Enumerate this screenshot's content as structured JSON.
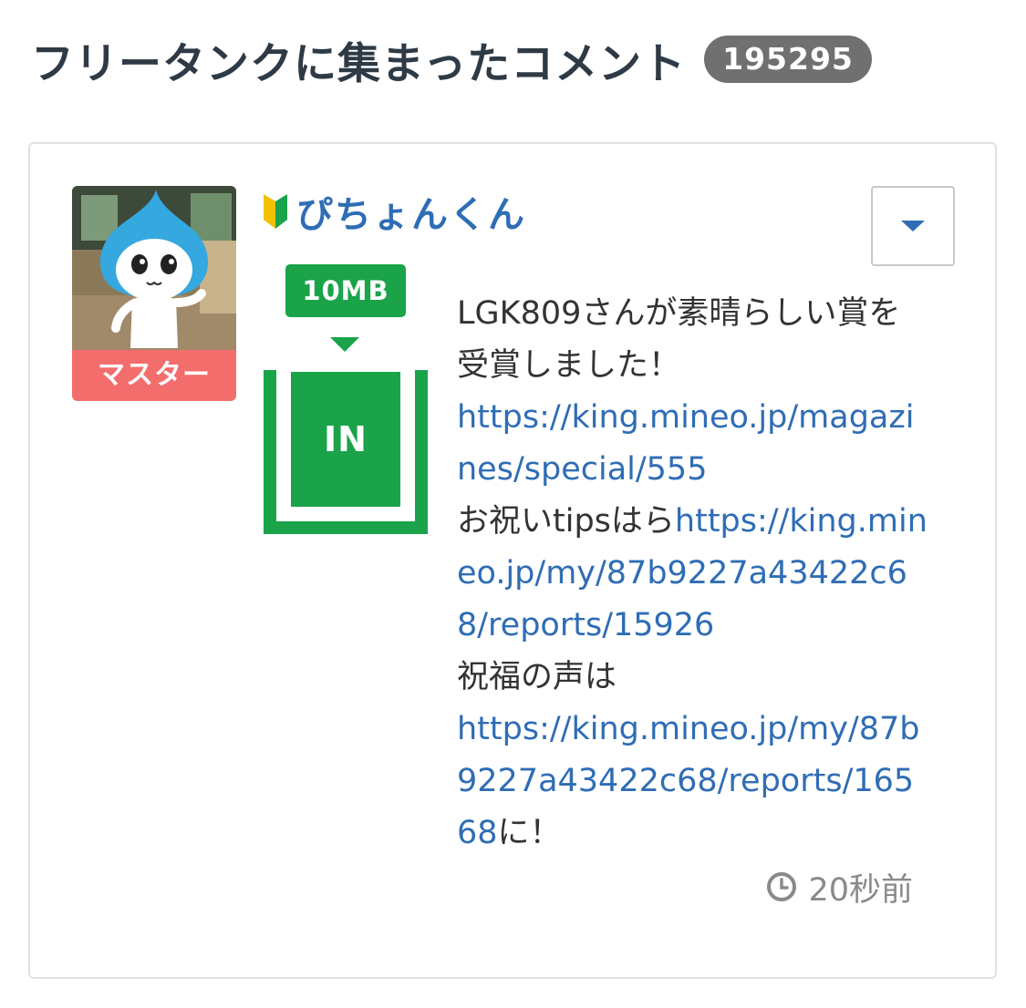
{
  "header": {
    "title": "フリータンクに集まったコメント",
    "count": "195295"
  },
  "comment": {
    "user": {
      "name": "ぴちょんくん",
      "rank": "マスター",
      "beginner_icon": "beginner-mark-icon",
      "avatar_icon": "mascot-avatar"
    },
    "tank": {
      "amount": "10MB",
      "direction_label": "IN",
      "color": "#1ba34a"
    },
    "body": {
      "text1": "LGK809さんが素晴らしい賞を受賞しました！",
      "link1": "https://king.mineo.jp/magazines/special/555",
      "text2": "お祝いtipsは",
      "text2b": "ら",
      "link2": "https://king.mineo.jp/my/87b9227a43422c68/reports/15926",
      "text3": "祝福の声は",
      "link3": "https://king.mineo.jp/my/87b9227a43422c68/reports/16568",
      "text4": "に！"
    },
    "timestamp": "20秒前",
    "menu_icon": "caret-down-icon"
  },
  "colors": {
    "link": "#2f6db5",
    "rank_badge": "#f36d6d",
    "count_badge": "#707070"
  }
}
